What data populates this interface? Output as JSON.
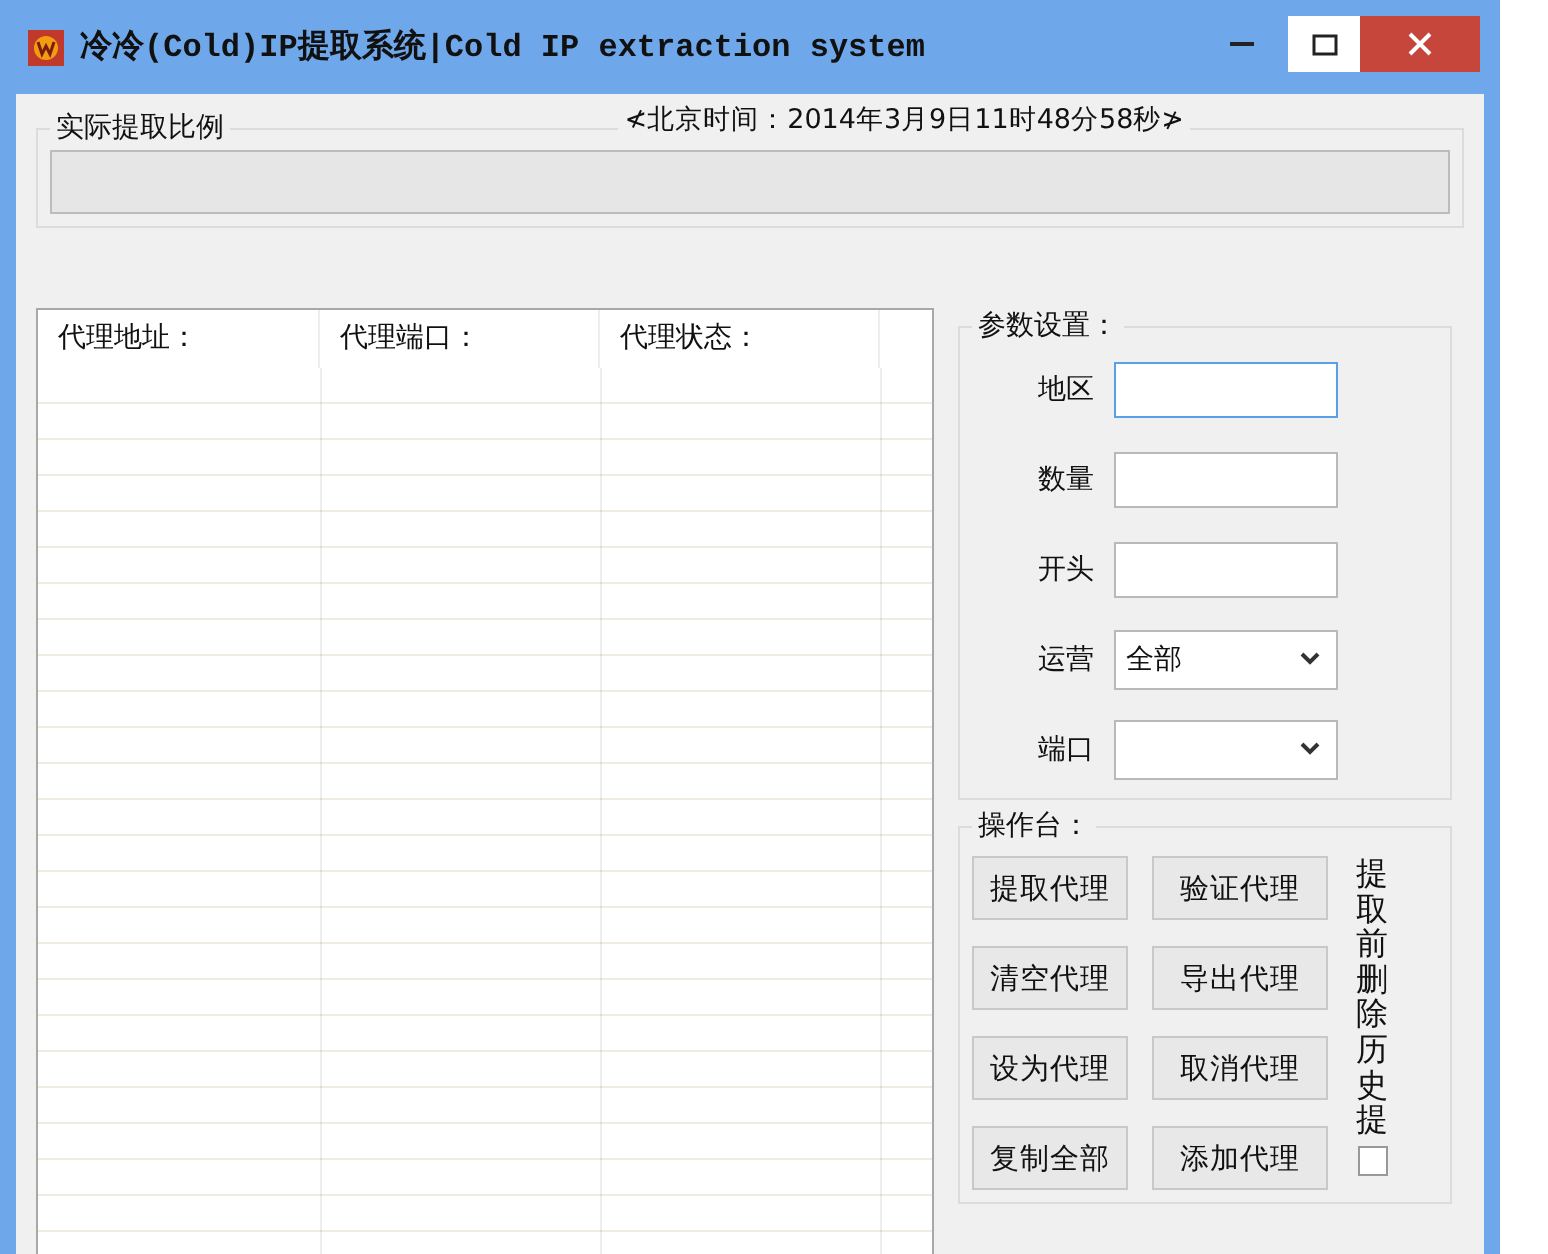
{
  "window": {
    "title": "冷冷(Cold)IP提取系统|Cold IP extraction system"
  },
  "ratio_group": {
    "label": "实际提取比例",
    "clock": "≮北京时间：2014年3月9日11时48分58秒≯",
    "level": 0
  },
  "proxy_table": {
    "columns": [
      "代理地址：",
      "代理端口：",
      "代理状态："
    ]
  },
  "settings": {
    "title": "参数设置：",
    "fields": [
      {
        "label": "地区",
        "kind": "text",
        "focused": true
      },
      {
        "label": "数量",
        "kind": "text",
        "focused": false
      },
      {
        "label": "开头",
        "kind": "text",
        "focused": false
      },
      {
        "label": "运营",
        "kind": "select",
        "value": "全部",
        "focused": false
      },
      {
        "label": "端口",
        "kind": "select",
        "focused": false
      }
    ]
  },
  "console": {
    "title": "操作台：",
    "buttons": [
      "提取代理",
      "验证代理",
      "清空代理",
      "导出代理",
      "设为代理",
      "取消代理",
      "复制全部",
      "添加代理"
    ],
    "option": {
      "label": "提取前删除历史提",
      "checked": false
    }
  }
}
